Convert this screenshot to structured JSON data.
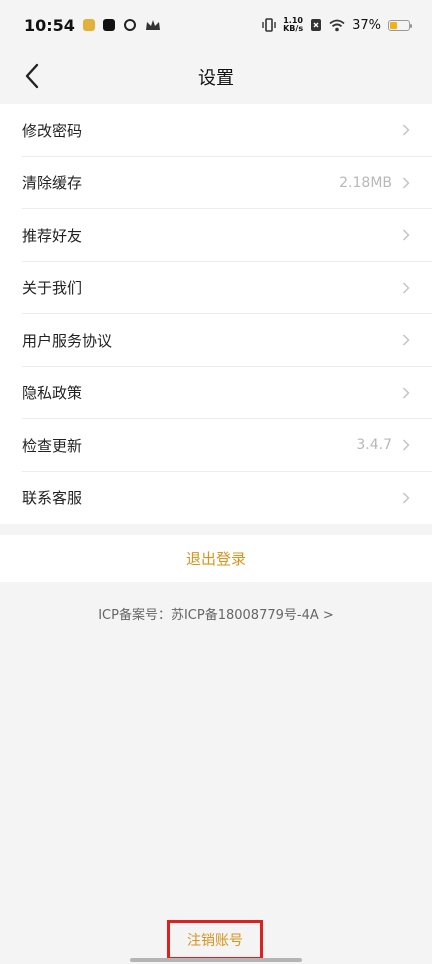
{
  "status_bar": {
    "time": "10:54",
    "net_speed_value": "1.10",
    "net_speed_unit": "KB/s",
    "battery_percent": "37%",
    "battery_level": 0.37
  },
  "header": {
    "title": "设置"
  },
  "settings": [
    {
      "label": "修改密码",
      "value": ""
    },
    {
      "label": "清除缓存",
      "value": "2.18MB"
    },
    {
      "label": "推荐好友",
      "value": ""
    },
    {
      "label": "关于我们",
      "value": ""
    },
    {
      "label": "用户服务协议",
      "value": ""
    },
    {
      "label": "隐私政策",
      "value": ""
    },
    {
      "label": "检查更新",
      "value": "3.4.7"
    },
    {
      "label": "联系客服",
      "value": ""
    }
  ],
  "logout_label": "退出登录",
  "icp_text": "ICP备案号：苏ICP备18008779号-4A >",
  "cancel_account_label": "注销账号",
  "colors": {
    "accent": "#d9941e",
    "highlight_border": "#e0201e"
  }
}
